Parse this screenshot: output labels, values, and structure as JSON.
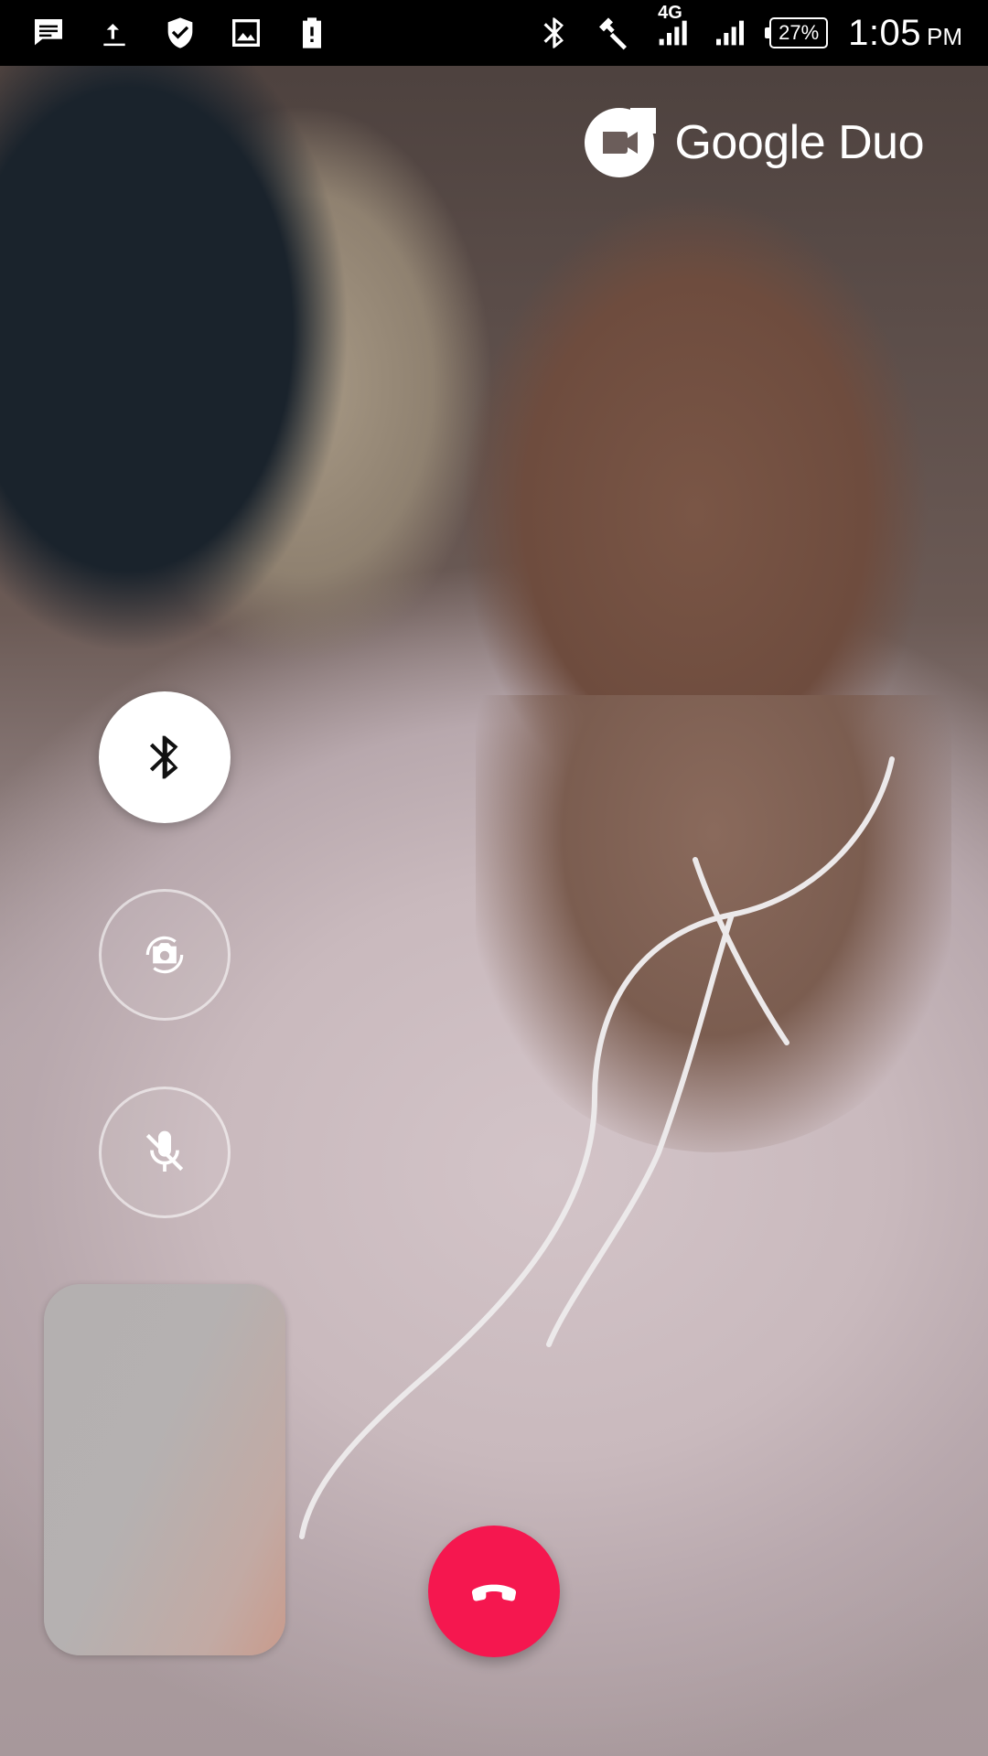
{
  "status_bar": {
    "network_label": "4G",
    "battery_percent": "27%",
    "time": "1:05",
    "ampm": "PM",
    "left_icons": [
      "message-icon",
      "upload-icon",
      "shield-check-icon",
      "image-icon",
      "battery-alert-icon"
    ],
    "right_icons": [
      "bluetooth-icon",
      "hammer-icon",
      "signal-4g-icon",
      "signal-icon",
      "battery-icon"
    ]
  },
  "logo": {
    "text": "Google Duo",
    "icon": "duo-camera-icon"
  },
  "controls": {
    "bluetooth": {
      "icon": "bluetooth-icon",
      "active": true
    },
    "flip_camera": {
      "icon": "flip-camera-icon",
      "active": false
    },
    "mute": {
      "icon": "mic-off-icon",
      "active": false
    }
  },
  "end_call": {
    "icon": "end-call-icon",
    "color": "#f5174f"
  },
  "colors": {
    "accent_end_call": "#f5174f",
    "status_bar_bg": "#000000",
    "control_active_bg": "#ffffff"
  }
}
